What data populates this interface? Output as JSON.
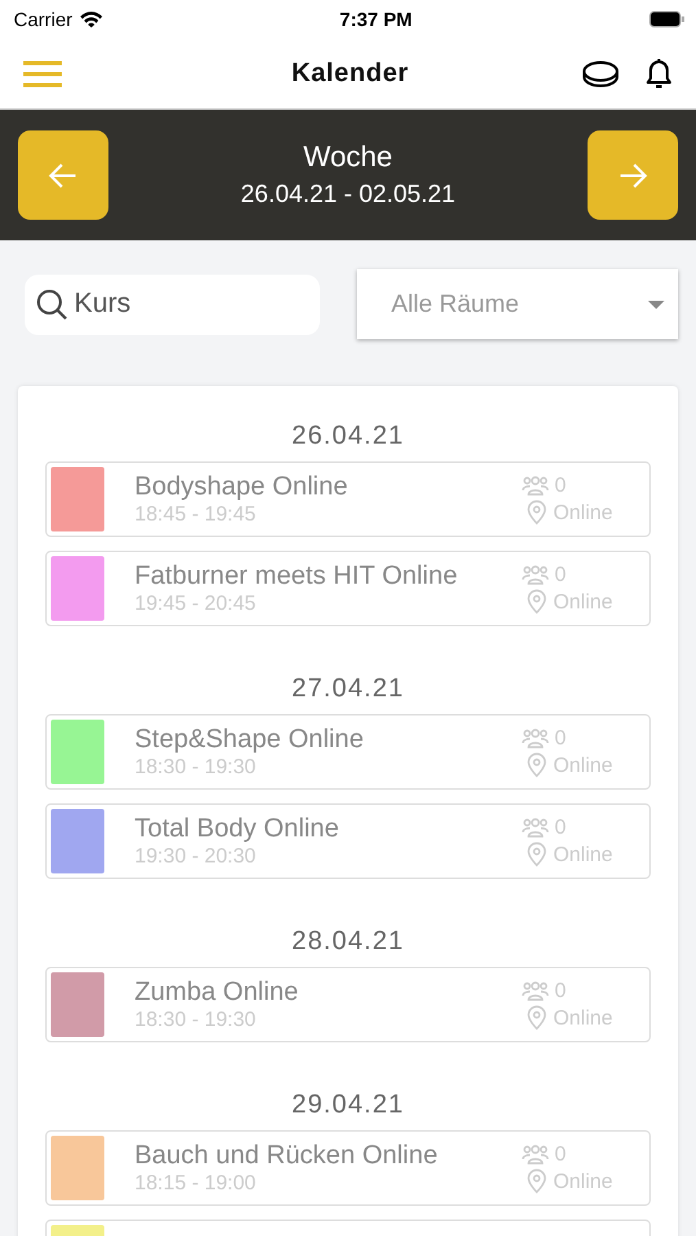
{
  "status_bar": {
    "carrier": "Carrier",
    "time": "7:37 PM"
  },
  "header": {
    "title": "Kalender"
  },
  "week_nav": {
    "label": "Woche",
    "range": "26.04.21 - 02.05.21"
  },
  "search": {
    "placeholder": "Kurs"
  },
  "room_select": {
    "value": "Alle Räume"
  },
  "days": [
    {
      "date": "26.04.21",
      "courses": [
        {
          "name": "Bodyshape Online",
          "time": "18:45 - 19:45",
          "participants": "0",
          "location": "Online",
          "color": "#f59a98"
        },
        {
          "name": "Fatburner meets HIT Online",
          "time": "19:45 - 20:45",
          "participants": "0",
          "location": "Online",
          "color": "#f39bef"
        }
      ]
    },
    {
      "date": "27.04.21",
      "courses": [
        {
          "name": "Step&Shape Online",
          "time": "18:30 - 19:30",
          "participants": "0",
          "location": "Online",
          "color": "#97f594"
        },
        {
          "name": "Total Body Online",
          "time": "19:30 - 20:30",
          "participants": "0",
          "location": "Online",
          "color": "#a0a7f0"
        }
      ]
    },
    {
      "date": "28.04.21",
      "courses": [
        {
          "name": "Zumba Online",
          "time": "18:30 - 19:30",
          "participants": "0",
          "location": "Online",
          "color": "#d19ba8"
        }
      ]
    },
    {
      "date": "29.04.21",
      "courses": [
        {
          "name": "Bauch und Rücken Online",
          "time": "18:15 - 19:00",
          "participants": "0",
          "location": "Online",
          "color": "#f8c79a"
        },
        {
          "color": "#f3f08a"
        }
      ]
    }
  ]
}
